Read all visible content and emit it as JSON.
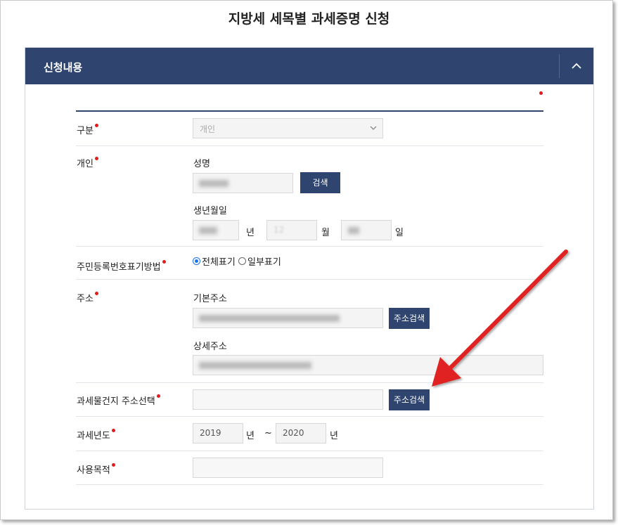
{
  "page_title": "지방세 세목별 과세증명 신청",
  "section": {
    "title": "신청내용",
    "collapse_icon": "chevron-up-icon"
  },
  "form": {
    "type": {
      "label": "구분",
      "value": "개인"
    },
    "individual": {
      "label": "개인",
      "name_label": "성명",
      "search_label": "검색",
      "birth_label": "생년월일",
      "year_unit": "년",
      "month_value": "12",
      "month_unit": "월",
      "day_unit": "일"
    },
    "rrn_display": {
      "label": "주민등록번호표기방법",
      "options": [
        "전체표기",
        "일부표기"
      ],
      "selected": "전체표기"
    },
    "address": {
      "label": "주소",
      "basic_label": "기본주소",
      "search_label": "주소검색",
      "detail_label": "상세주소"
    },
    "tax_location": {
      "label": "과세물건지 주소선택",
      "search_label": "주소검색"
    },
    "tax_year": {
      "label": "과세년도",
      "from": "2019",
      "unit": "년",
      "sep": "~",
      "to": "2020",
      "unit2": "년"
    },
    "purpose": {
      "label": "사용목적",
      "value": ""
    }
  },
  "colors": {
    "header": "#2f4570",
    "required": "#e31b1b",
    "annotation_arrow": "#e02020"
  }
}
